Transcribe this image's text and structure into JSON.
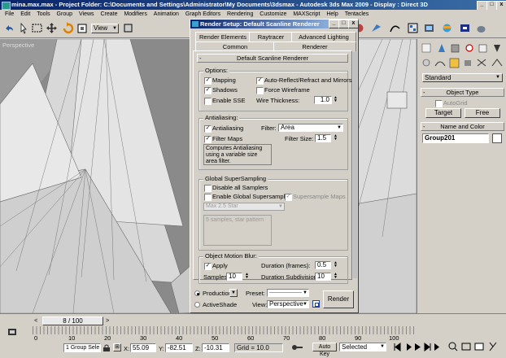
{
  "app": {
    "title": "mina.max.max  - Project Folder: C:\\Documents and Settings\\Administrator\\My Documents\\3dsmax   - Autodesk 3ds Max 2009      - Display : Direct 3D",
    "menu": [
      "File",
      "Edit",
      "Tools",
      "Group",
      "Views",
      "Create",
      "Modifiers",
      "Animation",
      "Graph Editors",
      "Rendering",
      "Customize",
      "MAXScript",
      "Help",
      "Tentacles"
    ],
    "view_dropdown": "View",
    "viewport_label": "Perspective"
  },
  "dialog": {
    "title": "Render Setup: Default Scanline Renderer",
    "tabs_row1": [
      "Render Elements",
      "Raytracer",
      "Advanced Lighting"
    ],
    "tabs_row2": [
      "Common",
      "Renderer"
    ],
    "rollout_title": "Default Scanline Renderer",
    "options": {
      "legend": "Options:",
      "mapping": "Mapping",
      "auto_reflect": "Auto-Reflect/Refract and Mirrors",
      "shadows": "Shadows",
      "force_wireframe": "Force Wireframe",
      "enable_sse": "Enable SSE",
      "wire_thickness_label": "Wire Thickness:",
      "wire_thickness_value": "1.0"
    },
    "antialiasing": {
      "legend": "Antialiasing:",
      "antialiasing": "Antialiasing",
      "filter_label": "Filter:",
      "filter_value": "Area",
      "filter_maps": "Filter Maps",
      "filter_size_label": "Filter Size:",
      "filter_size_value": "1.5",
      "description": "Computes Antialiasing using a variable size area filter."
    },
    "supersampling": {
      "legend": "Global SuperSampling",
      "disable_all": "Disable all Samplers",
      "enable_global": "Enable Global Supersampler",
      "supersample_maps": "Supersample Maps",
      "sampler_value": "Max 2.5 Star",
      "sampler_description": "5 samples, star pattern"
    },
    "motion_blur": {
      "legend": "Object Motion Blur:",
      "apply": "Apply",
      "duration_label": "Duration (frames):",
      "duration_value": "0.5",
      "samples_label": "Samples:",
      "samples_value": "10",
      "subdivisions_label": "Duration Subdivisions:",
      "subdivisions_value": "10"
    },
    "footer": {
      "production": "Production",
      "activeshade": "ActiveShade",
      "preset_label": "Preset:",
      "preset_value": "--------------------",
      "view_label": "View:",
      "view_value": "Perspective",
      "render_button": "Render"
    }
  },
  "command_panel": {
    "category": "Standard",
    "object_type_title": "Object Type",
    "autogrid": "AutoGrid",
    "target_button": "Target",
    "free_button": "Free",
    "name_color_title": "Name and Color",
    "object_name": "Group201"
  },
  "timeline": {
    "frame": "8 / 100",
    "ruler": [
      "0",
      "10",
      "20",
      "30",
      "40",
      "50",
      "60",
      "70",
      "80",
      "90",
      "100"
    ],
    "status": "1 Group Sele",
    "x_label": "X:",
    "x_value": "55.09",
    "y_label": "Y:",
    "y_value": "-82.51",
    "z_label": "Z:",
    "z_value": "-10.31",
    "grid": "Grid = 10.0",
    "auto_key": "Auto Key",
    "selected": "Selected"
  },
  "colors": {
    "title_blue": "#0a246a",
    "viewport_grey": "#808080",
    "panel_grey": "#d4d0c8"
  }
}
